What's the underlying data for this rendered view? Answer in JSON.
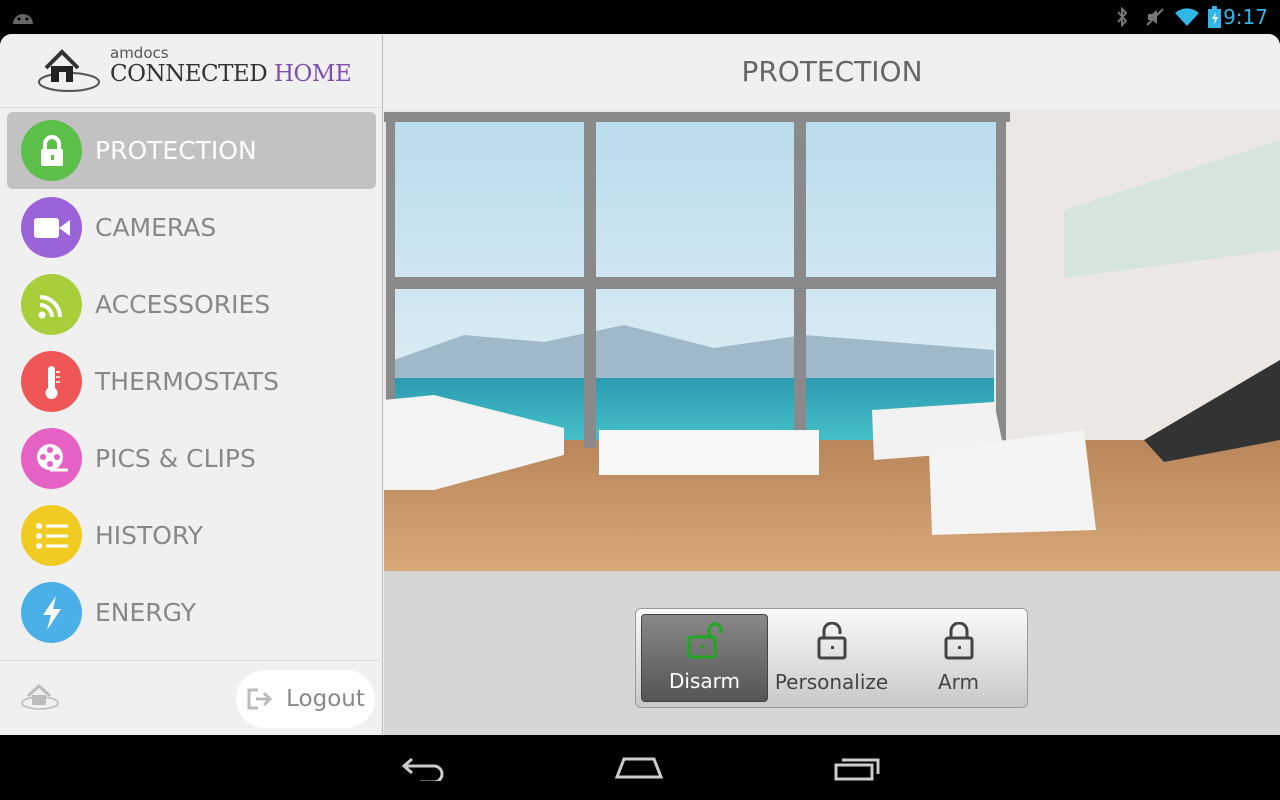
{
  "status_bar": {
    "time": "9:17",
    "icons": [
      "android-icon",
      "bluetooth-icon",
      "mute-icon",
      "wifi-icon",
      "battery-charging-icon"
    ],
    "accent": "#33b5e5"
  },
  "logo": {
    "brand": "amdocs",
    "title_main": "CONNECTED",
    "title_accent": "HOME",
    "accent": "#7e4fb0"
  },
  "sidebar": {
    "items": [
      {
        "label": "PROTECTION",
        "icon": "lock-icon",
        "color": "#5cbf4a",
        "active": true
      },
      {
        "label": "CAMERAS",
        "icon": "video-camera-icon",
        "color": "#9b63d8"
      },
      {
        "label": "ACCESSORIES",
        "icon": "wireless-icon",
        "color": "#a8cf3a"
      },
      {
        "label": "THERMOSTATS",
        "icon": "thermometer-icon",
        "color": "#ef5656"
      },
      {
        "label": "PICS & CLIPS",
        "icon": "film-reel-icon",
        "color": "#e661c4"
      },
      {
        "label": "HISTORY",
        "icon": "list-icon",
        "color": "#f0cc22"
      },
      {
        "label": "ENERGY",
        "icon": "lightning-icon",
        "color": "#4bb0e8"
      }
    ],
    "logout_label": "Logout"
  },
  "main": {
    "title": "PROTECTION",
    "modes": [
      {
        "label": "Disarm",
        "active": true
      },
      {
        "label": "Personalize"
      },
      {
        "label": "Arm"
      }
    ]
  }
}
